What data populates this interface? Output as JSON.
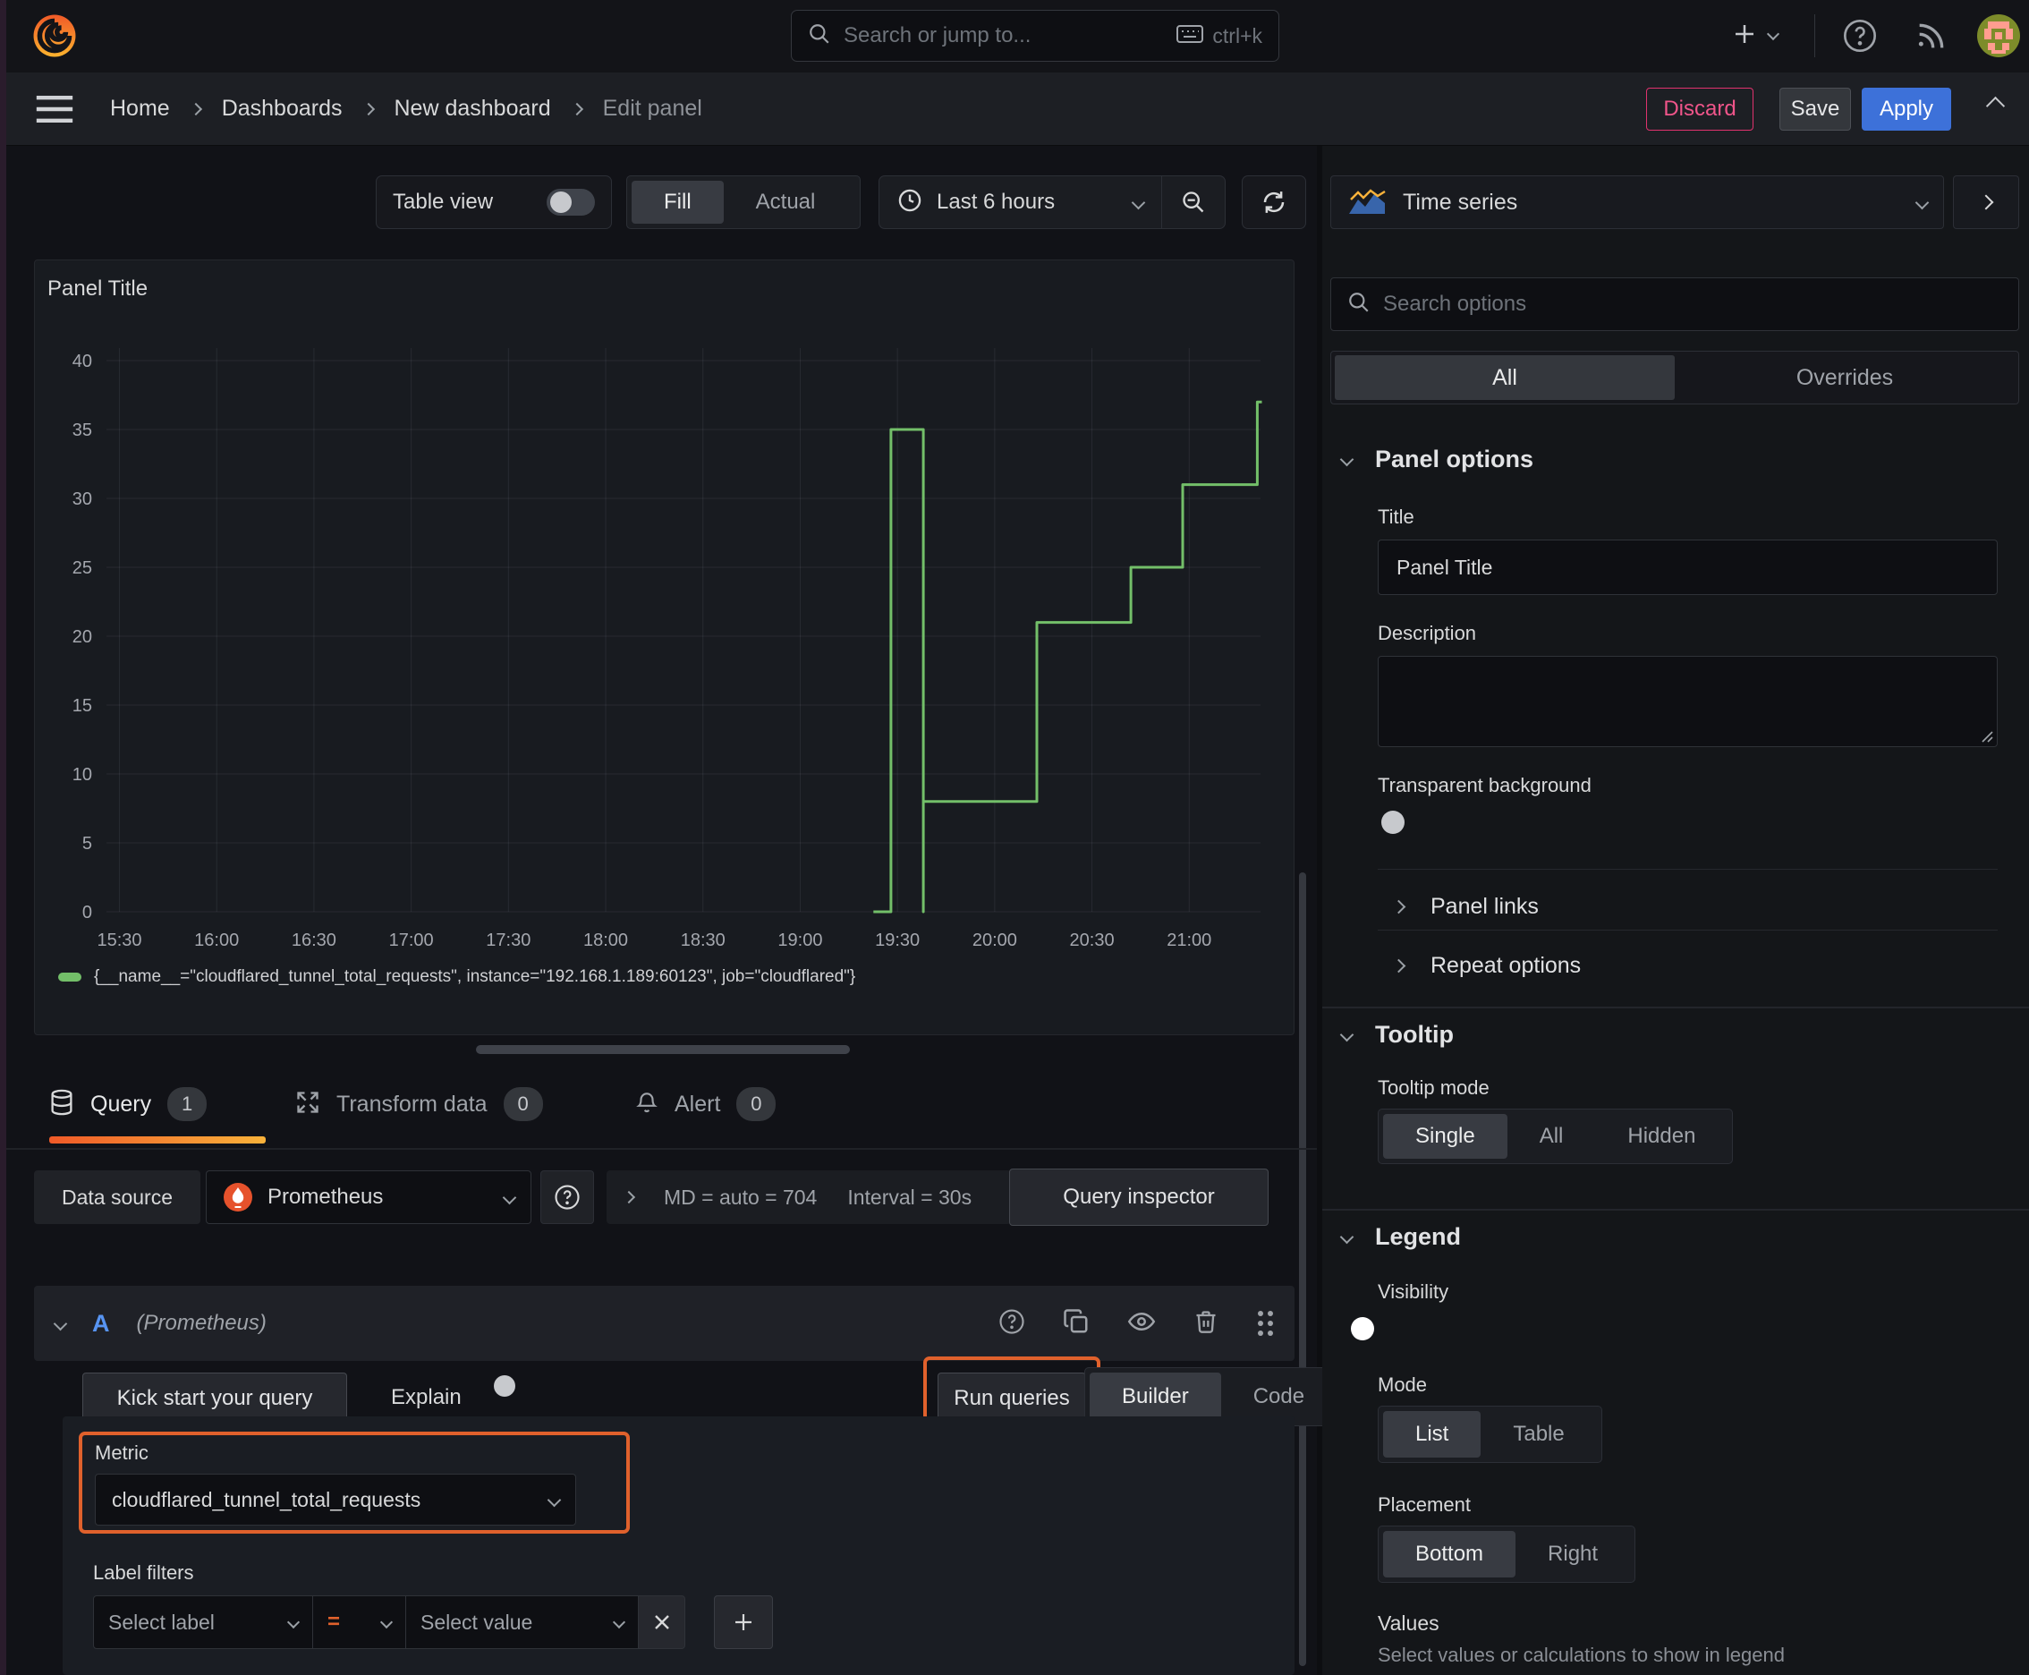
{
  "topbar": {
    "search_placeholder": "Search or jump to...",
    "search_shortcut": "ctrl+k"
  },
  "breadcrumb": {
    "items": [
      "Home",
      "Dashboards",
      "New dashboard",
      "Edit panel"
    ]
  },
  "actions": {
    "discard": "Discard",
    "save": "Save",
    "apply": "Apply"
  },
  "toolbar": {
    "table_view": "Table view",
    "fill": "Fill",
    "actual": "Actual",
    "time_range": "Last 6 hours"
  },
  "panel": {
    "title": "Panel Title"
  },
  "chart_data": {
    "type": "line",
    "title": "Panel Title",
    "xlabel": "",
    "ylabel": "",
    "ylim": [
      0,
      40
    ],
    "y_ticks": [
      0,
      5,
      10,
      15,
      20,
      25,
      30,
      35,
      40
    ],
    "x_ticks": [
      "15:30",
      "16:00",
      "16:30",
      "17:00",
      "17:30",
      "18:00",
      "18:30",
      "19:00",
      "19:30",
      "20:00",
      "20:30",
      "21:00"
    ],
    "x_domain_minutes": [
      926,
      1282
    ],
    "grid": true,
    "legend_position": "bottom",
    "series": [
      {
        "name": "{__name__=\"cloudflared_tunnel_total_requests\", instance=\"192.168.1.189:60123\", job=\"cloudflared\"}",
        "color": "#73bf69",
        "points": [
          [
            1163,
            0
          ],
          [
            1168,
            0
          ],
          [
            1168,
            35
          ],
          [
            1178,
            35
          ],
          [
            1178,
            0
          ],
          [
            1178,
            8
          ],
          [
            1213,
            8
          ],
          [
            1213,
            21
          ],
          [
            1242,
            21
          ],
          [
            1242,
            25
          ],
          [
            1258,
            25
          ],
          [
            1258,
            31
          ],
          [
            1281,
            31
          ],
          [
            1281,
            37
          ],
          [
            1282,
            37
          ]
        ]
      }
    ]
  },
  "tabs": {
    "query": "Query",
    "query_count": "1",
    "transform": "Transform data",
    "transform_count": "0",
    "alert": "Alert",
    "alert_count": "0"
  },
  "datasource_row": {
    "label": "Data source",
    "name": "Prometheus",
    "stats": "MD = auto = 704",
    "interval": "Interval = 30s",
    "inspector": "Query inspector"
  },
  "query_row": {
    "letter": "A",
    "datasource": "(Prometheus)"
  },
  "query_actions": {
    "kickstart": "Kick start your query",
    "explain": "Explain",
    "run": "Run queries",
    "builder": "Builder",
    "code": "Code"
  },
  "metric": {
    "label": "Metric",
    "value": "cloudflared_tunnel_total_requests"
  },
  "label_filters": {
    "label": "Label filters",
    "select_label": "Select label",
    "operator": "=",
    "select_value": "Select value"
  },
  "viz_picker": {
    "name": "Time series"
  },
  "options_search": {
    "placeholder": "Search options"
  },
  "options_tabs": {
    "all": "All",
    "overrides": "Overrides"
  },
  "panel_options": {
    "header": "Panel options",
    "title_label": "Title",
    "title_value": "Panel Title",
    "description_label": "Description",
    "transparent_label": "Transparent background"
  },
  "collapsed_sections": {
    "panel_links": "Panel links",
    "repeat_options": "Repeat options"
  },
  "tooltip_section": {
    "header": "Tooltip",
    "mode_label": "Tooltip mode",
    "single": "Single",
    "all": "All",
    "hidden": "Hidden"
  },
  "legend_section": {
    "header": "Legend",
    "visibility_label": "Visibility",
    "mode_label": "Mode",
    "list": "List",
    "table": "Table",
    "placement_label": "Placement",
    "bottom": "Bottom",
    "right": "Right",
    "values_label": "Values",
    "values_help": "Select values or calculations to show in legend"
  },
  "colors": {
    "series_green": "#73bf69",
    "highlight_orange": "#e0612c",
    "accent_blue": "#3d71d9",
    "destructive_pink": "#e0326e",
    "tab_underline_from": "#f05a28",
    "tab_underline_to": "#f9b23a"
  }
}
